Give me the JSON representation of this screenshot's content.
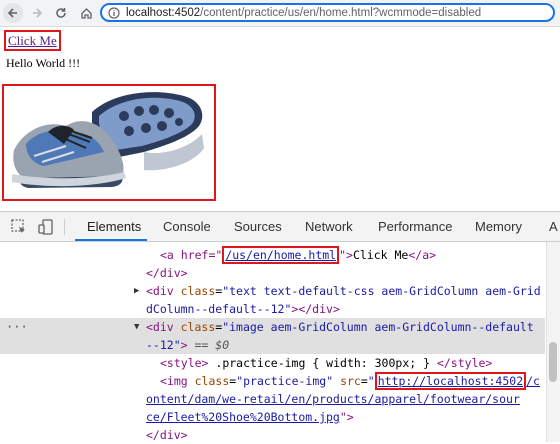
{
  "browser": {
    "url_host": "localhost:4502",
    "url_path": "/content/practice/us/en/home.html?wcmmode=disabled"
  },
  "page": {
    "link_label": "Click Me",
    "hello_text": "Hello World !!!"
  },
  "devtools": {
    "tabs": [
      "Elements",
      "Console",
      "Sources",
      "Network",
      "Performance",
      "Memory",
      "A"
    ],
    "code": {
      "l1_open": "<a href=\"",
      "l1_url": "/us/en/home.html",
      "l1_close": "\">",
      "l1_text": "Click Me",
      "l1_end": "</a>",
      "l2": "</div>",
      "l3_div": "<div ",
      "l3_attr": "class",
      "l3_val": "\"text text-default-css aem-GridColumn aem-Grid",
      "l4_val": "dColumn--default--12\"",
      "l4_rest": "></div>",
      "l5_div": "<div ",
      "l5_attr": "class",
      "l5_val": "\"image aem-GridColumn aem-GridColumn--default",
      "l6_val": "--12\"",
      "l6_gt": ">",
      "l6_eq": "== $0",
      "l7_open": "<style>",
      "l7_text": " .practice-img { width: 300px; } ",
      "l7_close": "</style>",
      "l8_img": "<img ",
      "l8_attr1": "class",
      "l8_val1": "\"practice-img\"",
      "l8_attr2": "src",
      "l8_url1": "http://localhost:4502",
      "l8_url2": "/c",
      "l9_url": "ontent/dam/we-retail/en/products/apparel/footwear/sour",
      "l10_url": "ce/Fleet%20Shoe%20Bottom.jpg",
      "l10_end": "\">",
      "l11": "</div>",
      "ellipsis": "···",
      "collapsed": "…"
    }
  }
}
